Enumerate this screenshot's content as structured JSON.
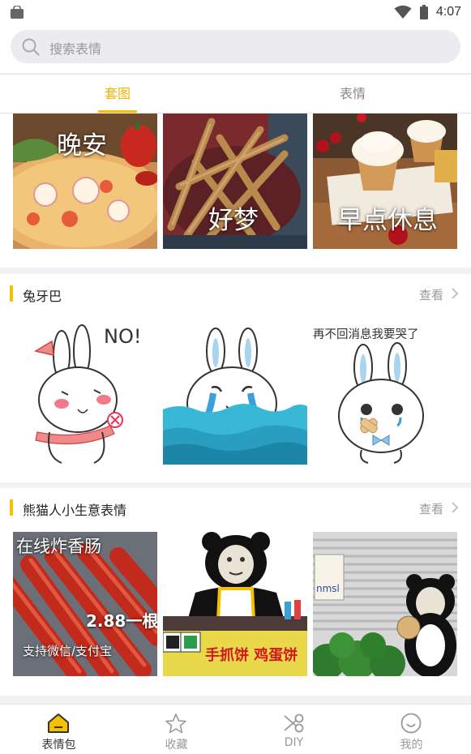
{
  "status_bar": {
    "time": "4:07"
  },
  "search": {
    "placeholder": "搜索表情"
  },
  "tabs": [
    {
      "label": "套图",
      "active": true
    },
    {
      "label": "表情",
      "active": false
    }
  ],
  "top_tiles": [
    {
      "caption": "晚安",
      "image": "pizza"
    },
    {
      "caption": "好梦",
      "image": "breadsticks"
    },
    {
      "caption": "早点休息",
      "image": "cupcakes"
    }
  ],
  "sections": [
    {
      "title": "兔牙巴",
      "more_label": "查看",
      "items": [
        {
          "image": "bunny-blush",
          "text": "NO!"
        },
        {
          "image": "bunny-crying-water",
          "text": ""
        },
        {
          "image": "bunny-bandage",
          "text": "再不回消息我要哭了"
        }
      ]
    },
    {
      "title": "熊猫人小生意表情",
      "more_label": "查看",
      "items": [
        {
          "image": "sausages",
          "text_top": "在线炸香肠",
          "text_price": "2.88一根",
          "text_bottom": "支持微信/支付宝"
        },
        {
          "image": "panda-stall",
          "text": "手抓饼 鸡蛋饼"
        },
        {
          "image": "panda-watermelon",
          "text": "nmsl"
        }
      ]
    }
  ],
  "bottom_nav": [
    {
      "label": "表情包",
      "icon": "home-icon",
      "active": true
    },
    {
      "label": "收藏",
      "icon": "star-icon",
      "active": false
    },
    {
      "label": "DIY",
      "icon": "scissors-icon",
      "active": false
    },
    {
      "label": "我的",
      "icon": "smile-icon",
      "active": false
    }
  ],
  "colors": {
    "accent": "#f5c000",
    "tab_active": "#f0b400",
    "background": "#f2f2f2"
  }
}
